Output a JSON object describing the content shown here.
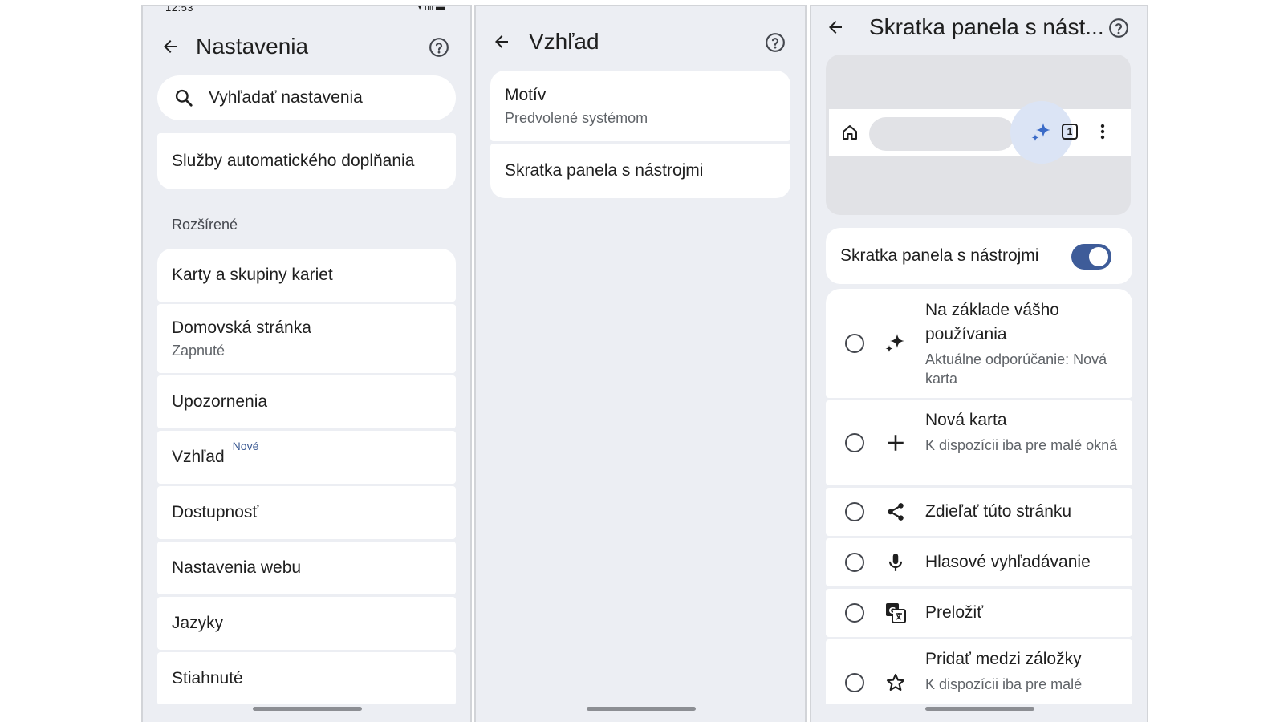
{
  "status_bar": {
    "time": "12:53",
    "icons": "wifi signal battery"
  },
  "settings": {
    "title": "Nastavenia",
    "search_placeholder": "Vyhľadať nastavenia",
    "autofill": "Služby automatického doplňania",
    "section_advanced": "Rozšírené",
    "items": [
      {
        "label": "Karty a skupiny kariet"
      },
      {
        "label": "Domovská stránka",
        "sub": "Zapnuté"
      },
      {
        "label": "Upozornenia"
      },
      {
        "label": "Vzhľad",
        "badge": "Nové"
      },
      {
        "label": "Dostupnosť"
      },
      {
        "label": "Nastavenia webu"
      },
      {
        "label": "Jazyky"
      },
      {
        "label": "Stiahnuté"
      }
    ]
  },
  "appearance": {
    "title": "Vzhľad",
    "theme_label": "Motív",
    "theme_value": "Predvolené systémom",
    "toolbar_shortcut": "Skratka panela s nástrojmi"
  },
  "shortcut": {
    "title": "Skratka panela s nást...",
    "tab_count": "1",
    "toggle_label": "Skratka panela s nástrojmi",
    "toggle_on": true,
    "accent": "#3e5c99",
    "options": [
      {
        "title": "Na základe vášho používania",
        "sub": "Aktuálne odporúčanie: Nová karta",
        "icon": "sparkle-icon",
        "selected": false
      },
      {
        "title": "Nová karta",
        "sub": "K dispozícii iba pre malé okná",
        "icon": "plus-icon",
        "selected": false
      },
      {
        "title": "Zdieľať túto stránku",
        "sub": "",
        "icon": "share-icon",
        "selected": false
      },
      {
        "title": "Hlasové vyhľadávanie",
        "sub": "",
        "icon": "mic-icon",
        "selected": false
      },
      {
        "title": "Preložiť",
        "sub": "",
        "icon": "translate-icon",
        "selected": false
      },
      {
        "title": "Pridať medzi záložky",
        "sub": "K dispozícii iba pre malé",
        "icon": "star-icon",
        "selected": false
      }
    ]
  }
}
